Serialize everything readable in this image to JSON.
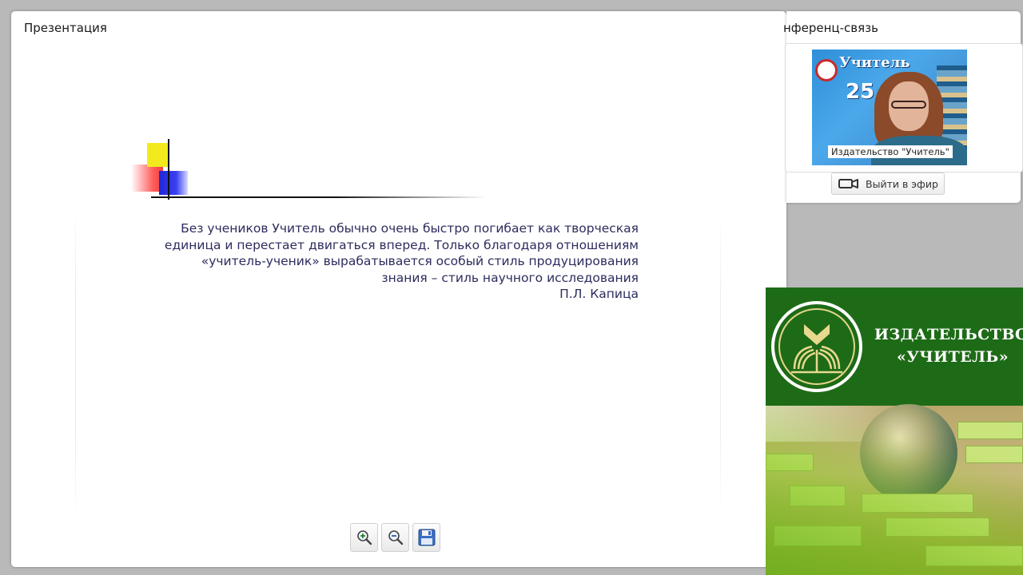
{
  "presentation": {
    "title": "Презентация",
    "quote_lines": [
      "Без учеников Учитель обычно очень быстро погибает как творческая",
      "единица и перестает двигаться вперед. Только благодаря отношениям",
      "«учитель-ученик» вырабатывается особый стиль продуцирования",
      "знания – стиль научного исследования",
      "П.Л. Капица"
    ],
    "toolbar": {
      "zoom_in_icon": "zoom-in-icon",
      "zoom_out_icon": "zoom-out-icon",
      "save_icon": "save-icon"
    }
  },
  "conference": {
    "title": "нференц-связь",
    "video_caption": "Издательство \"Учитель\"",
    "video_brand": "Учитель",
    "video_number": "25",
    "go_live_label": "Выйти в эфир"
  },
  "banner": {
    "line1": "ИЗДАТЕЛЬСТВО",
    "line2": "«УЧИТЕЛЬ»"
  },
  "colors": {
    "banner_green": "#1e6b17",
    "quote_text": "#2c2c5e",
    "deco_yellow": "#f2ea1c",
    "deco_red": "#f2403d",
    "deco_blue": "#1f26d8"
  }
}
